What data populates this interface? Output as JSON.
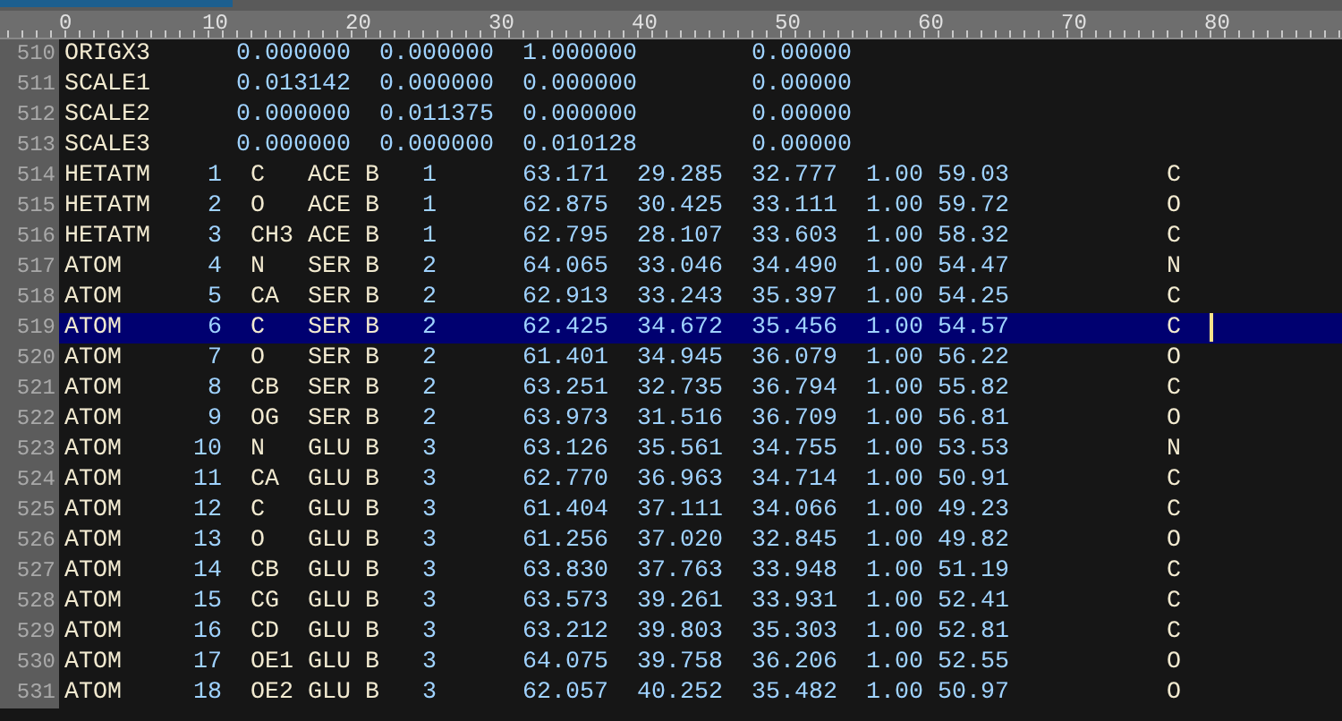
{
  "ruler": {
    "labels": [
      "0",
      "10",
      "20",
      "30",
      "40",
      "50",
      "60",
      "70",
      "80"
    ]
  },
  "lines": [
    {
      "number": "510",
      "text": "ORIGX3      0.000000  0.000000  1.000000        0.00000",
      "selected": false
    },
    {
      "number": "511",
      "text": "SCALE1      0.013142  0.000000  0.000000        0.00000",
      "selected": false
    },
    {
      "number": "512",
      "text": "SCALE2      0.000000  0.011375  0.000000        0.00000",
      "selected": false
    },
    {
      "number": "513",
      "text": "SCALE3      0.000000  0.000000  0.010128        0.00000",
      "selected": false
    },
    {
      "number": "514",
      "text": "HETATM    1  C   ACE B   1      63.171  29.285  32.777  1.00 59.03           C",
      "selected": false
    },
    {
      "number": "515",
      "text": "HETATM    2  O   ACE B   1      62.875  30.425  33.111  1.00 59.72           O",
      "selected": false
    },
    {
      "number": "516",
      "text": "HETATM    3  CH3 ACE B   1      62.795  28.107  33.603  1.00 58.32           C",
      "selected": false
    },
    {
      "number": "517",
      "text": "ATOM      4  N   SER B   2      64.065  33.046  34.490  1.00 54.47           N",
      "selected": false
    },
    {
      "number": "518",
      "text": "ATOM      5  CA  SER B   2      62.913  33.243  35.397  1.00 54.25           C",
      "selected": false
    },
    {
      "number": "519",
      "text": "ATOM      6  C   SER B   2      62.425  34.672  35.456  1.00 54.57           C",
      "selected": true
    },
    {
      "number": "520",
      "text": "ATOM      7  O   SER B   2      61.401  34.945  36.079  1.00 56.22           O",
      "selected": false
    },
    {
      "number": "521",
      "text": "ATOM      8  CB  SER B   2      63.251  32.735  36.794  1.00 55.82           C",
      "selected": false
    },
    {
      "number": "522",
      "text": "ATOM      9  OG  SER B   2      63.973  31.516  36.709  1.00 56.81           O",
      "selected": false
    },
    {
      "number": "523",
      "text": "ATOM     10  N   GLU B   3      63.126  35.561  34.755  1.00 53.53           N",
      "selected": false
    },
    {
      "number": "524",
      "text": "ATOM     11  CA  GLU B   3      62.770  36.963  34.714  1.00 50.91           C",
      "selected": false
    },
    {
      "number": "525",
      "text": "ATOM     12  C   GLU B   3      61.404  37.111  34.066  1.00 49.23           C",
      "selected": false
    },
    {
      "number": "526",
      "text": "ATOM     13  O   GLU B   3      61.256  37.020  32.845  1.00 49.82           O",
      "selected": false
    },
    {
      "number": "527",
      "text": "ATOM     14  CB  GLU B   3      63.830  37.763  33.948  1.00 51.19           C",
      "selected": false
    },
    {
      "number": "528",
      "text": "ATOM     15  CG  GLU B   3      63.573  39.261  33.931  1.00 52.41           C",
      "selected": false
    },
    {
      "number": "529",
      "text": "ATOM     16  CD  GLU B   3      63.212  39.803  35.303  1.00 52.81           C",
      "selected": false
    },
    {
      "number": "530",
      "text": "ATOM     17  OE1 GLU B   3      64.075  39.758  36.206  1.00 52.55           O",
      "selected": false
    },
    {
      "number": "531",
      "text": "ATOM     18  OE2 GLU B   3      62.057  40.252  35.482  1.00 50.97           O",
      "selected": false
    }
  ]
}
